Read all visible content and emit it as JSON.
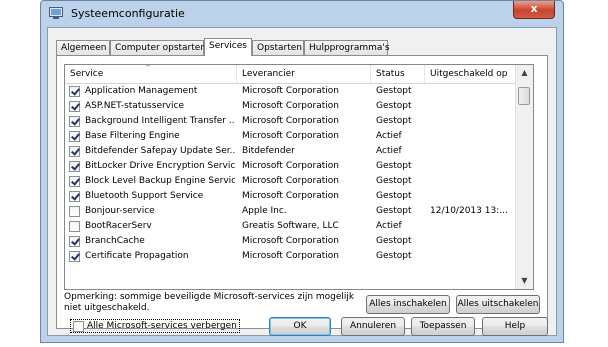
{
  "window": {
    "title": "Systeemconfiguratie",
    "close_label": "x",
    "icon": "msconfig-icon"
  },
  "tabs": [
    {
      "label": "Algemeen",
      "active": false
    },
    {
      "label": "Computer opstarten",
      "active": false
    },
    {
      "label": "Services",
      "active": true
    },
    {
      "label": "Opstarten",
      "active": false
    },
    {
      "label": "Hulpprogramma's",
      "active": false
    }
  ],
  "list": {
    "columns": [
      "Service",
      "Leverancier",
      "Status",
      "Uitgeschakeld op"
    ],
    "sort_indicator": "^",
    "rows": [
      {
        "checked": true,
        "service": "Application Management",
        "vendor": "Microsoft Corporation",
        "status": "Gestopt",
        "disabled_on": ""
      },
      {
        "checked": true,
        "service": "ASP.NET-statusservice",
        "vendor": "Microsoft Corporation",
        "status": "Gestopt",
        "disabled_on": ""
      },
      {
        "checked": true,
        "service": "Background Intelligent Transfer ...",
        "vendor": "Microsoft Corporation",
        "status": "Gestopt",
        "disabled_on": ""
      },
      {
        "checked": true,
        "service": "Base Filtering Engine",
        "vendor": "Microsoft Corporation",
        "status": "Actief",
        "disabled_on": ""
      },
      {
        "checked": true,
        "service": "Bitdefender Safepay Update Ser...",
        "vendor": "Bitdefender",
        "status": "Actief",
        "disabled_on": ""
      },
      {
        "checked": true,
        "service": "BitLocker Drive Encryption Service",
        "vendor": "Microsoft Corporation",
        "status": "Gestopt",
        "disabled_on": ""
      },
      {
        "checked": true,
        "service": "Block Level Backup Engine Service",
        "vendor": "Microsoft Corporation",
        "status": "Gestopt",
        "disabled_on": ""
      },
      {
        "checked": true,
        "service": "Bluetooth Support Service",
        "vendor": "Microsoft Corporation",
        "status": "Gestopt",
        "disabled_on": ""
      },
      {
        "checked": false,
        "service": "Bonjour-service",
        "vendor": "Apple Inc.",
        "status": "Gestopt",
        "disabled_on": "12/10/2013 13:..."
      },
      {
        "checked": false,
        "service": "BootRacerServ",
        "vendor": "Greatis Software, LLC",
        "status": "Actief",
        "disabled_on": ""
      },
      {
        "checked": true,
        "service": "BranchCache",
        "vendor": "Microsoft Corporation",
        "status": "Gestopt",
        "disabled_on": ""
      },
      {
        "checked": true,
        "service": "Certificate Propagation",
        "vendor": "Microsoft Corporation",
        "status": "Gestopt",
        "disabled_on": ""
      }
    ]
  },
  "note": "Opmerking: sommige beveiligde Microsoft-services zijn mogelijk niet uitgeschakeld.",
  "enable_all_label": "Alles inschakelen",
  "disable_all_label": "Alles uitschakelen",
  "hide_ms_label": "Alle Microsoft-services verbergen",
  "hide_ms_checked": false,
  "buttons": {
    "ok": "OK",
    "cancel": "Annuleren",
    "apply": "Toepassen",
    "help": "Help"
  }
}
